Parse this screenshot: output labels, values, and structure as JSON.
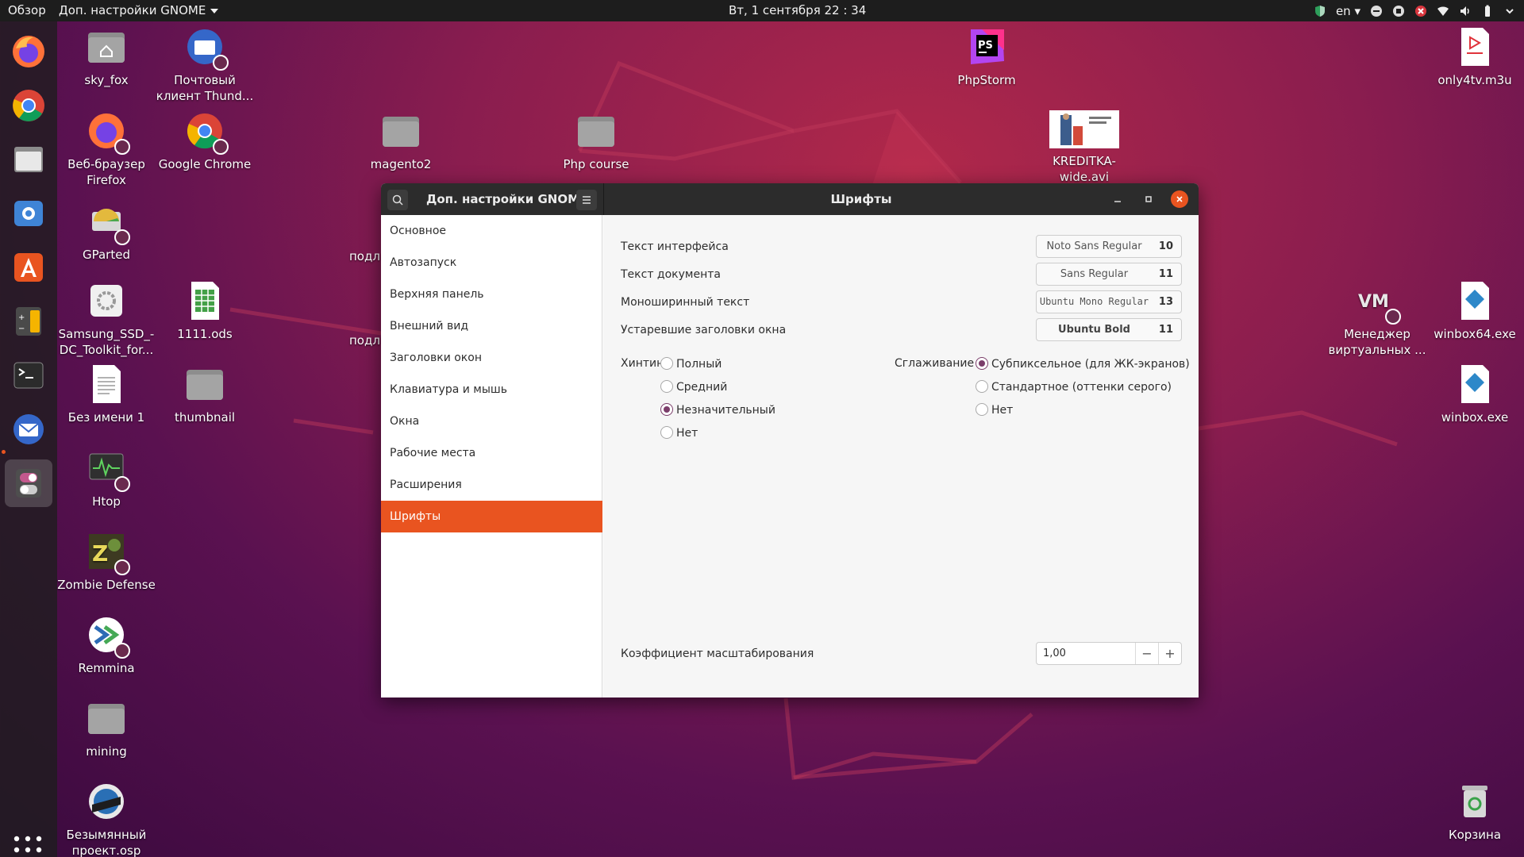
{
  "topbar": {
    "overview": "Обзор",
    "app_menu": "Доп. настройки GNOME",
    "clock": "Вт, 1 сентября  22 : 34",
    "lang": "en"
  },
  "dock": {
    "items": [
      "firefox",
      "chrome",
      "files",
      "thunderbird-mail",
      "software-center",
      "calculator",
      "terminal",
      "thunderbird",
      "tweaks"
    ]
  },
  "desktop": {
    "icons": [
      {
        "label": "sky_fox"
      },
      {
        "label": "Почтовый клиент Thund..."
      },
      {
        "label": "Веб-браузер Firefox"
      },
      {
        "label": "Google Chrome"
      },
      {
        "label": "magento2"
      },
      {
        "label": "Php course"
      },
      {
        "label": "PhpStorm"
      },
      {
        "label": "KREDITKA-wide.avi"
      },
      {
        "label": "only4tv.m3u"
      },
      {
        "label": "GParted"
      },
      {
        "label": "Samsung_SSD_-DC_Toolkit_for..."
      },
      {
        "label": "1111.ods"
      },
      {
        "label": "Без имени 1"
      },
      {
        "label": "thumbnail"
      },
      {
        "label": "Htop"
      },
      {
        "label": "Zombie Defense"
      },
      {
        "label": "Remmina"
      },
      {
        "label": "mining"
      },
      {
        "label": "Безымянный проект.osp"
      },
      {
        "label": "Менеджер виртуальных ..."
      },
      {
        "label": "winbox64.exe"
      },
      {
        "label": "winbox.exe"
      },
      {
        "label": "Корзина"
      }
    ],
    "partial_labels": [
      "подл",
      "подл"
    ]
  },
  "window": {
    "app_title": "Доп. настройки GNOME",
    "page_title": "Шрифты",
    "sidebar": [
      {
        "label": "Основное"
      },
      {
        "label": "Автозапуск"
      },
      {
        "label": "Верхняя панель"
      },
      {
        "label": "Внешний вид"
      },
      {
        "label": "Заголовки окон"
      },
      {
        "label": "Клавиатура и мышь"
      },
      {
        "label": "Окна"
      },
      {
        "label": "Рабочие места"
      },
      {
        "label": "Расширения"
      },
      {
        "label": "Шрифты",
        "selected": true
      }
    ],
    "fonts": [
      {
        "label": "Текст интерфейса",
        "font": "Noto Sans Regular",
        "size": "10"
      },
      {
        "label": "Текст документа",
        "font": "Sans Regular",
        "size": "11"
      },
      {
        "label": "Моноширинный текст",
        "font": "Ubuntu Mono Regular",
        "size": "13"
      },
      {
        "label": "Устаревшие заголовки окна",
        "font": "Ubuntu Bold",
        "size": "11"
      }
    ],
    "hinting": {
      "label": "Хинтинг",
      "options": [
        {
          "label": "Полный",
          "checked": false
        },
        {
          "label": "Средний",
          "checked": false
        },
        {
          "label": "Незначительный",
          "checked": true
        },
        {
          "label": "Нет",
          "checked": false
        }
      ]
    },
    "antialiasing": {
      "label": "Сглаживание",
      "options": [
        {
          "label": "Субпиксельное (для ЖК-экранов)",
          "checked": true
        },
        {
          "label": "Стандартное (оттенки серого)",
          "checked": false
        },
        {
          "label": "Нет",
          "checked": false
        }
      ]
    },
    "scaling": {
      "label": "Коэффициент масштабирования",
      "value": "1,00",
      "minus": "−",
      "plus": "+"
    }
  },
  "colors": {
    "accent": "#e95420",
    "radio_selected": "#7b3d6a",
    "titlebar": "#2c2c2c",
    "topbar": "#1d1d1d"
  }
}
